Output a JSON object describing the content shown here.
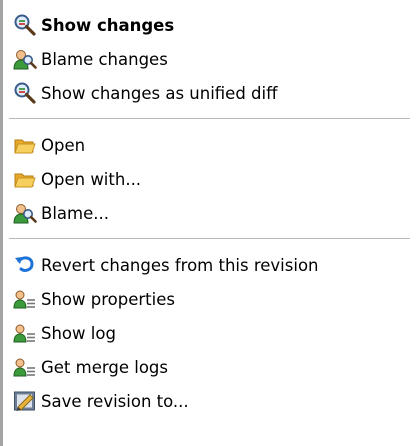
{
  "menu": {
    "groups": [
      {
        "items": [
          {
            "label": "Show changes",
            "icon": "magnifier-diff-icon",
            "default": true
          },
          {
            "label": "Blame changes",
            "icon": "blame-user-magnifier-icon"
          },
          {
            "label": "Show changes as unified diff",
            "icon": "magnifier-diff-icon"
          }
        ]
      },
      {
        "items": [
          {
            "label": "Open",
            "icon": "folder-open-icon"
          },
          {
            "label": "Open with...",
            "icon": "folder-open-icon"
          },
          {
            "label": "Blame...",
            "icon": "blame-user-magnifier-icon"
          }
        ]
      },
      {
        "items": [
          {
            "label": "Revert changes from this revision",
            "icon": "revert-arrow-icon"
          },
          {
            "label": "Show properties",
            "icon": "properties-user-list-icon"
          },
          {
            "label": "Show log",
            "icon": "log-user-list-icon"
          },
          {
            "label": "Get merge logs",
            "icon": "merge-log-user-list-icon"
          },
          {
            "label": "Save revision to...",
            "icon": "save-revision-pencil-icon"
          }
        ]
      }
    ]
  },
  "colors": {
    "text": "#000000",
    "background": "#ffffff",
    "separator": "#b9b9b9",
    "left_border": "#a4a4a4",
    "folder": "#f3c040",
    "revert_arrow": "#1e73d8"
  }
}
